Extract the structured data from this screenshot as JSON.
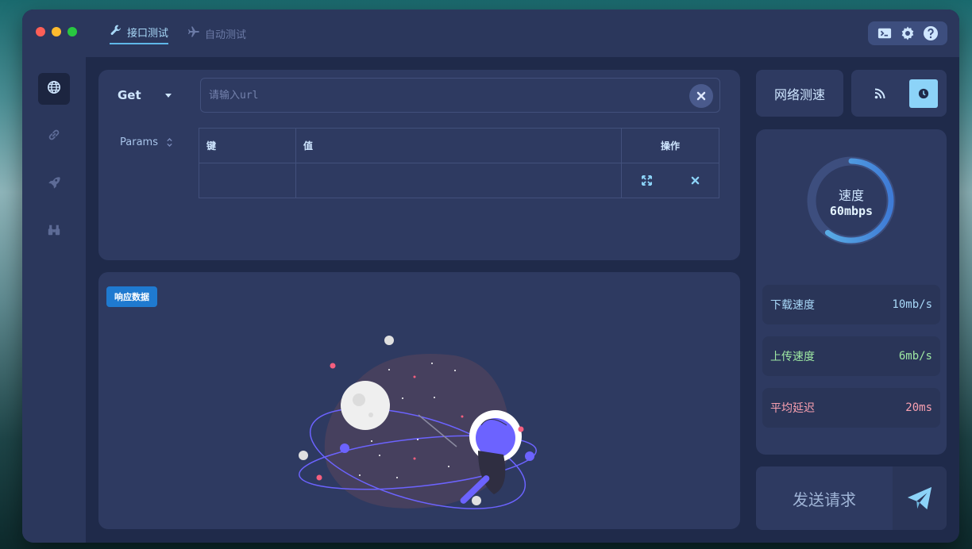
{
  "titlebar": {
    "tabs": [
      {
        "label": "接口测试",
        "icon": "wrench-icon",
        "active": true
      },
      {
        "label": "自动测试",
        "icon": "airplane-icon",
        "active": false
      }
    ],
    "tools": [
      "terminal-icon",
      "gear-icon",
      "help-icon"
    ]
  },
  "sidebar": {
    "items": [
      {
        "icon": "globe-icon",
        "active": true
      },
      {
        "icon": "link-icon",
        "active": false
      },
      {
        "icon": "rocket-icon",
        "active": false
      },
      {
        "icon": "binoculars-icon",
        "active": false
      }
    ]
  },
  "request": {
    "method": "Get",
    "url_placeholder": "请输入url",
    "url_value": "",
    "params_label": "Params",
    "table": {
      "headers": [
        "键",
        "值",
        "操作"
      ],
      "rows": [
        {
          "key": "",
          "value": ""
        }
      ]
    }
  },
  "response": {
    "badge": "响应数据"
  },
  "network": {
    "speed_test_label": "网络测速",
    "gauge_label": "速度",
    "gauge_value": "60mbps",
    "gauge_fraction": 0.6,
    "stats": [
      {
        "label": "下载速度",
        "value": "10mb/s",
        "color": "#a8d8f8"
      },
      {
        "label": "上传速度",
        "value": "6mb/s",
        "color": "#9ee8a3"
      },
      {
        "label": "平均延迟",
        "value": "20ms",
        "color": "#f8a0b0"
      }
    ]
  },
  "send": {
    "label": "发送请求"
  },
  "colors": {
    "accent": "#5fb7e8",
    "panel": "#2e3a61",
    "window": "#1f2a4a"
  }
}
